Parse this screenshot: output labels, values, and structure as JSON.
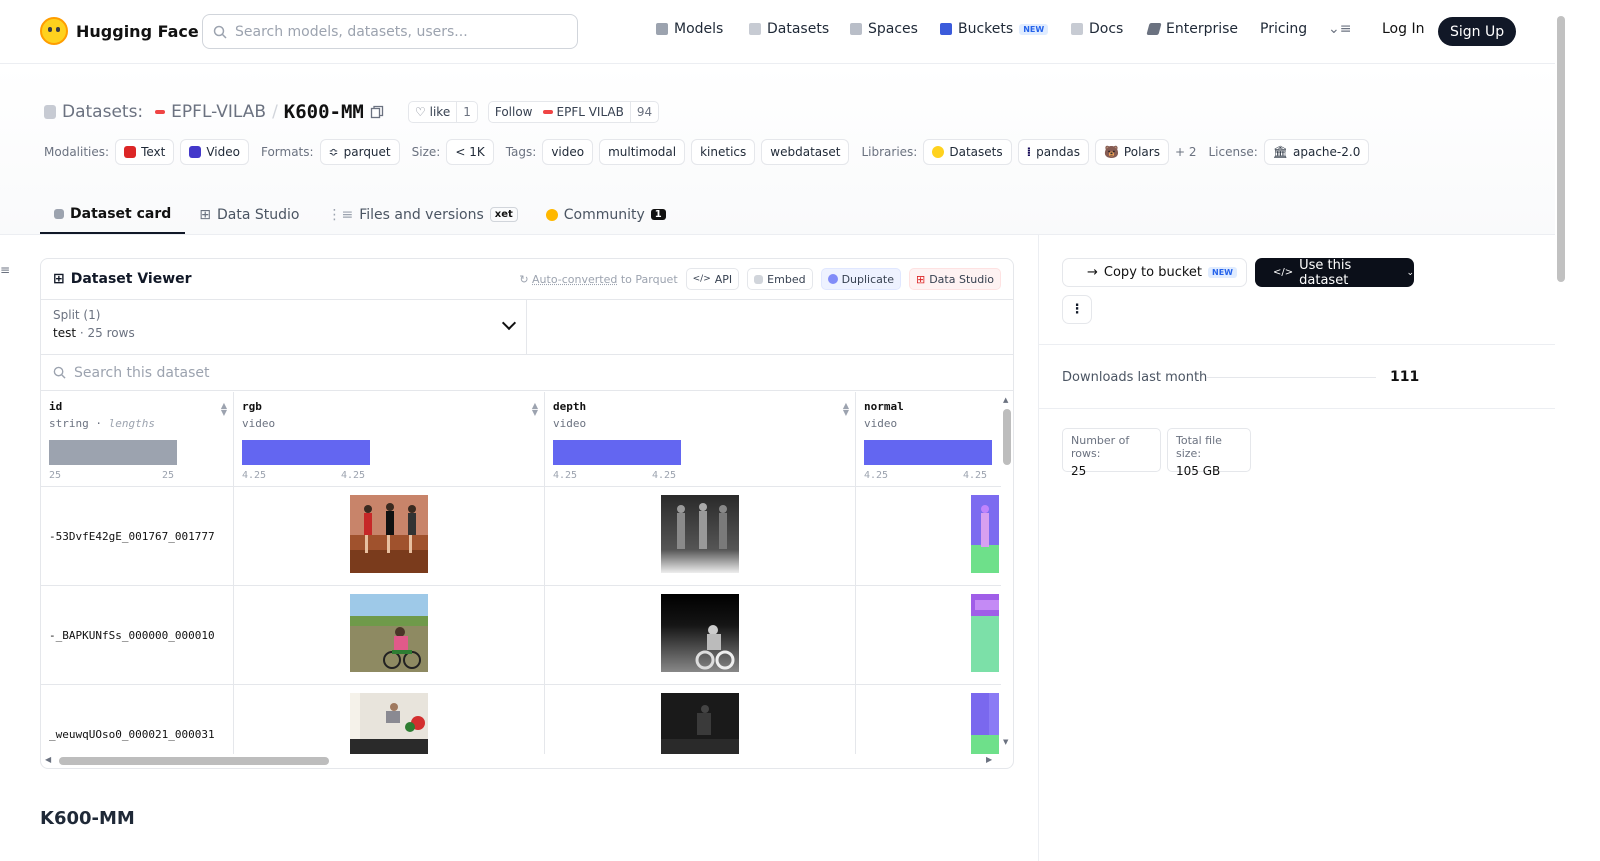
{
  "header": {
    "brand": "Hugging Face",
    "search_placeholder": "Search models, datasets, users...",
    "nav": [
      {
        "label": "Models"
      },
      {
        "label": "Datasets"
      },
      {
        "label": "Spaces"
      },
      {
        "label": "Buckets",
        "badge": "NEW"
      },
      {
        "label": "Docs"
      },
      {
        "label": "Enterprise"
      },
      {
        "label": "Pricing"
      }
    ],
    "login": "Log In",
    "signup": "Sign Up"
  },
  "dataset": {
    "section_label": "Datasets:",
    "org": "EPFL-VILAB",
    "separator": "/",
    "name": "K600-MM",
    "like_label": "like",
    "like_count": "1",
    "follow_label": "Follow",
    "follow_org": "EPFL VILAB",
    "follow_count": "94"
  },
  "meta": {
    "modalities_label": "Modalities:",
    "modalities": [
      "Text",
      "Video"
    ],
    "formats_label": "Formats:",
    "formats": [
      "parquet"
    ],
    "size_label": "Size:",
    "size": "< 1K",
    "tags_label": "Tags:",
    "tags": [
      "video",
      "multimodal",
      "kinetics",
      "webdataset"
    ],
    "libraries_label": "Libraries:",
    "libraries": [
      "Datasets",
      "pandas",
      "Polars"
    ],
    "libraries_more": "+ 2",
    "license_label": "License:",
    "license": "apache-2.0"
  },
  "tabs": [
    {
      "label": "Dataset card",
      "active": true
    },
    {
      "label": "Data Studio"
    },
    {
      "label": "Files and versions",
      "badge": "xet"
    },
    {
      "label": "Community",
      "count": "1"
    }
  ],
  "viewer": {
    "title": "Dataset Viewer",
    "auto_converted_link": "Auto-converted",
    "auto_converted_rest": " to Parquet",
    "actions": [
      "API",
      "Embed",
      "Duplicate",
      "Data Studio"
    ],
    "split_label": "Split (1)",
    "split_value": "test",
    "split_rows": "25 rows",
    "search_placeholder": "Search this dataset",
    "columns": [
      {
        "name": "id",
        "type": "string",
        "type_extra": "lengths",
        "min": "25",
        "max": "25"
      },
      {
        "name": "rgb",
        "type": "video",
        "min": "4.25",
        "max": "4.25"
      },
      {
        "name": "depth",
        "type": "video",
        "min": "4.25",
        "max": "4.25"
      },
      {
        "name": "normal",
        "type": "video",
        "min": "4.25",
        "max": "4.25"
      }
    ],
    "rows": [
      {
        "id": "-53DvfE42gE_001767_001777"
      },
      {
        "id": "-_BAPKUNfSs_000000_000010"
      },
      {
        "id": "_weuwqUOso0_000021_000031"
      }
    ]
  },
  "sidebar": {
    "copy_to_bucket": "Copy to bucket",
    "copy_badge": "NEW",
    "use_dataset": "Use this dataset",
    "downloads_label": "Downloads last month",
    "downloads_value": "111",
    "rows_label": "Number of rows:",
    "rows_value": "25",
    "filesize_label": "Total file size:",
    "filesize_value": "105 GB"
  },
  "card_title": "K600-MM",
  "colors": {
    "accent": "#6366f1",
    "histogram_gray": "#9ca3af",
    "brand_yellow": "#ffd21e"
  }
}
